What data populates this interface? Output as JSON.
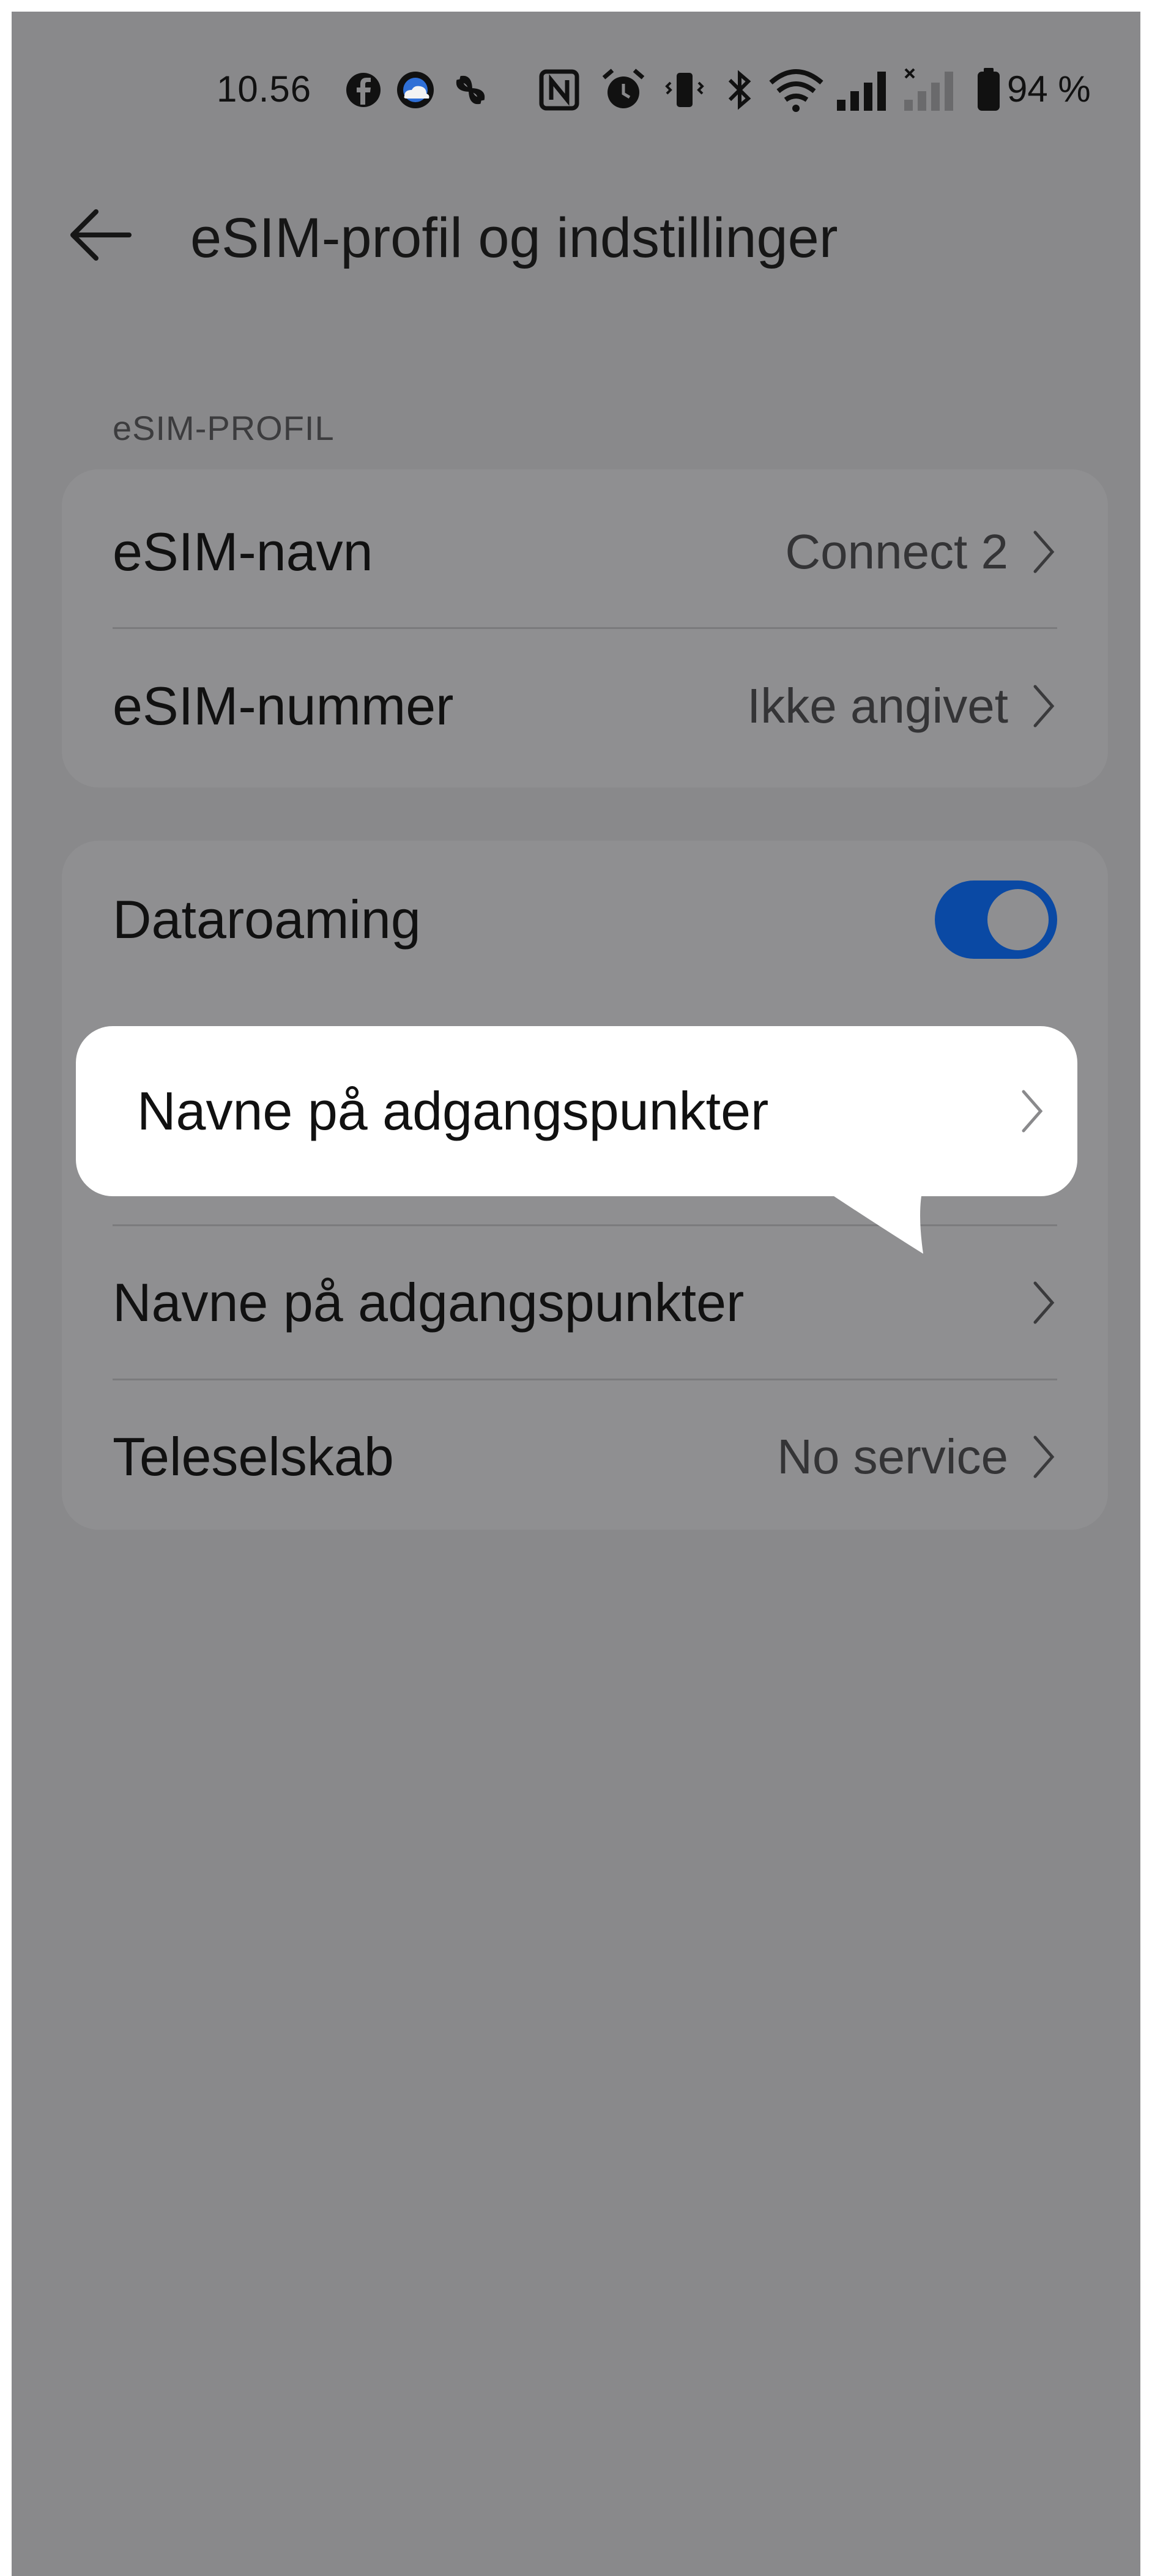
{
  "status_bar": {
    "time": "10.56",
    "battery": "94 %",
    "icons": [
      "facebook-icon",
      "weather-icon",
      "fan-icon",
      "nfc-icon",
      "alarm-icon",
      "vibrate-icon",
      "bluetooth-icon",
      "wifi-icon",
      "signal-icon",
      "signal-nosim-icon",
      "battery-icon"
    ]
  },
  "header": {
    "title": "eSIM-profil og indstillinger",
    "back_icon": "arrow-left-icon"
  },
  "section_label": "eSIM-PROFIL",
  "profile_rows": [
    {
      "label": "eSIM-navn",
      "value": "Connect 2"
    },
    {
      "label": "eSIM-nummer",
      "value": "Ikke angivet"
    }
  ],
  "settings_rows": {
    "dataroaming": {
      "label": "Dataroaming",
      "enabled": true
    },
    "apn": {
      "label": "Navne på adgangspunkter"
    },
    "carrier": {
      "label": "Teleselskab",
      "value": "No service"
    }
  },
  "callout": {
    "label": "Navne på adgangspunkter"
  },
  "colors": {
    "dim_background": "#89898b",
    "toggle_on": "#0a49a4",
    "callout_bg": "#ffffff"
  }
}
